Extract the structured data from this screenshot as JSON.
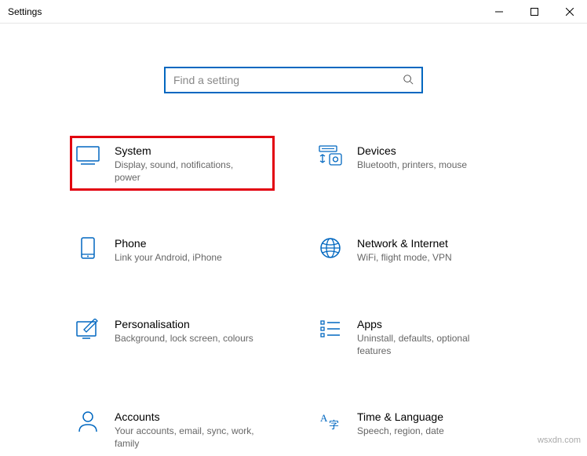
{
  "window": {
    "title": "Settings"
  },
  "search": {
    "placeholder": "Find a setting",
    "value": ""
  },
  "categories": [
    {
      "id": "system",
      "title": "System",
      "desc": "Display, sound, notifications, power",
      "highlight": true
    },
    {
      "id": "devices",
      "title": "Devices",
      "desc": "Bluetooth, printers, mouse",
      "highlight": false
    },
    {
      "id": "phone",
      "title": "Phone",
      "desc": "Link your Android, iPhone",
      "highlight": false
    },
    {
      "id": "network",
      "title": "Network & Internet",
      "desc": "WiFi, flight mode, VPN",
      "highlight": false
    },
    {
      "id": "personalisation",
      "title": "Personalisation",
      "desc": "Background, lock screen, colours",
      "highlight": false
    },
    {
      "id": "apps",
      "title": "Apps",
      "desc": "Uninstall, defaults, optional features",
      "highlight": false
    },
    {
      "id": "accounts",
      "title": "Accounts",
      "desc": "Your accounts, email, sync, work, family",
      "highlight": false
    },
    {
      "id": "time",
      "title": "Time & Language",
      "desc": "Speech, region, date",
      "highlight": false
    }
  ],
  "watermark": "wsxdn.com"
}
